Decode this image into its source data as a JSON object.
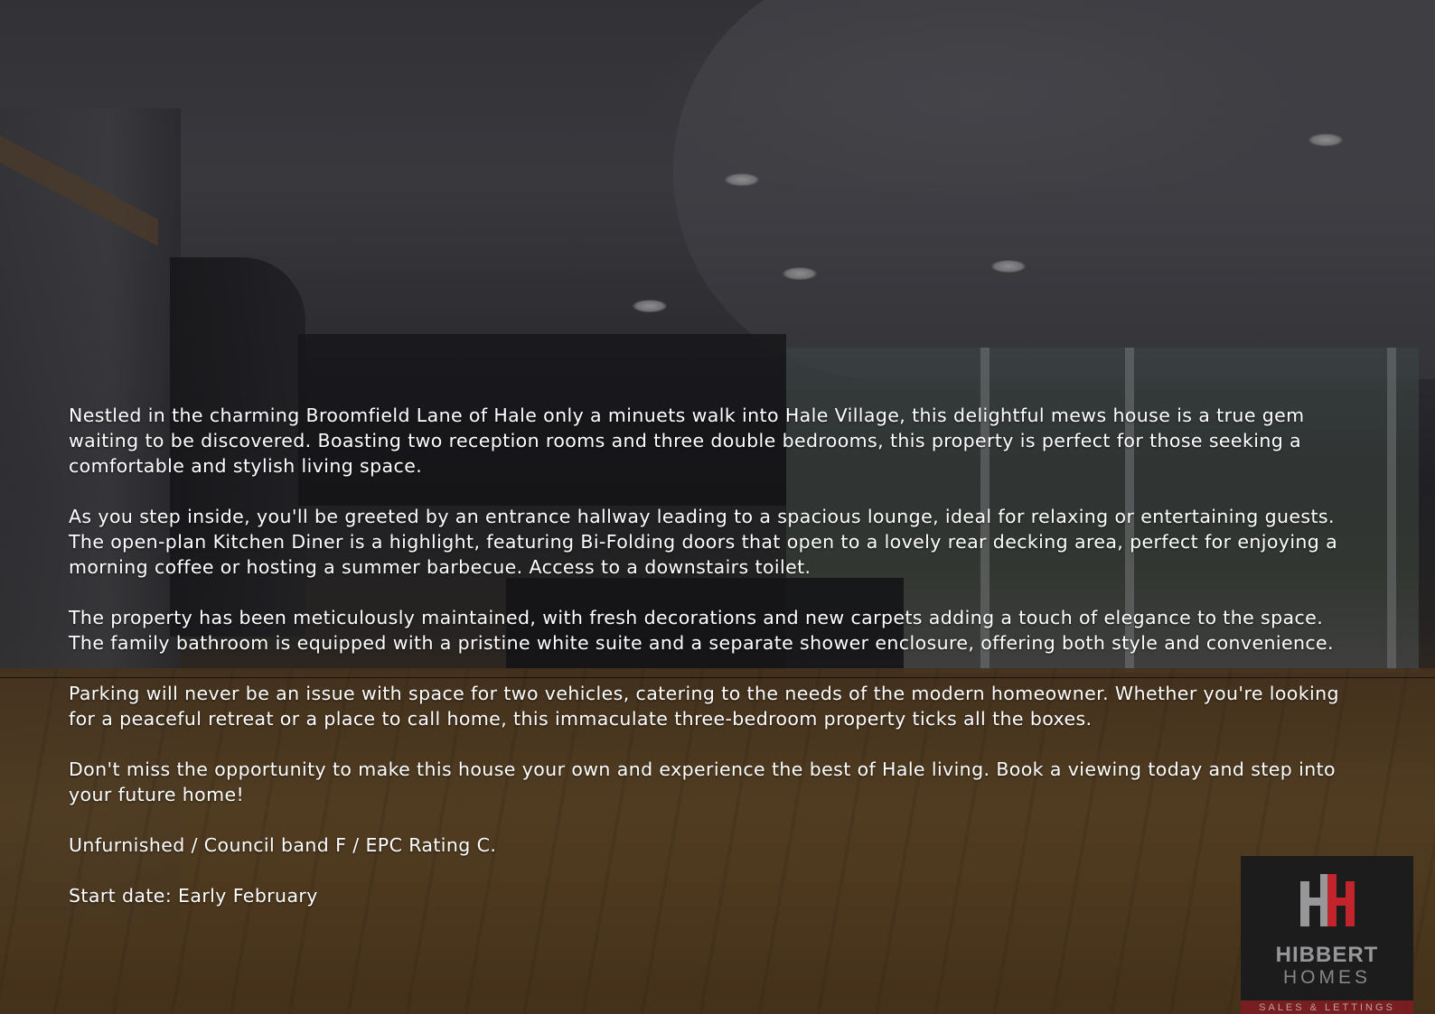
{
  "description": {
    "paragraphs": [
      "Nestled in the charming Broomfield Lane of Hale only a minuets walk into Hale Village, this delightful mews house is a true gem waiting to be discovered. Boasting two reception rooms and three double bedrooms, this property is perfect for those seeking a comfortable and stylish living space.",
      "As you step inside, you'll be greeted by an entrance hallway leading to a spacious lounge, ideal for relaxing or entertaining guests. The open-plan Kitchen Diner is a highlight, featuring Bi-Folding doors that open to a lovely rear decking area, perfect for enjoying a morning coffee or hosting a summer barbecue. Access to a downstairs toilet.",
      "The property has been meticulously maintained, with fresh decorations and new carpets adding a touch of elegance to the space. The family bathroom is equipped with a pristine white suite and a separate shower enclosure, offering both style and convenience.",
      "Parking will never be an issue with space for two vehicles, catering to the needs of the modern homeowner. Whether you're looking for a peaceful retreat or a place to call home, this immaculate three-bedroom property ticks all the boxes.",
      "Don't miss the opportunity to make this house your own and experience the best of Hale living. Book a viewing today and step into your future home!",
      "Unfurnished / Council band F / EPC Rating C.",
      "Start date: Early February"
    ]
  },
  "logo": {
    "name": "HIBBERT",
    "sub": "HOMES",
    "tagline": "SALES & LETTINGS",
    "colors": {
      "grey": "#9c9ca0",
      "red": "#c8232c",
      "box": "#1b1b1d"
    }
  }
}
